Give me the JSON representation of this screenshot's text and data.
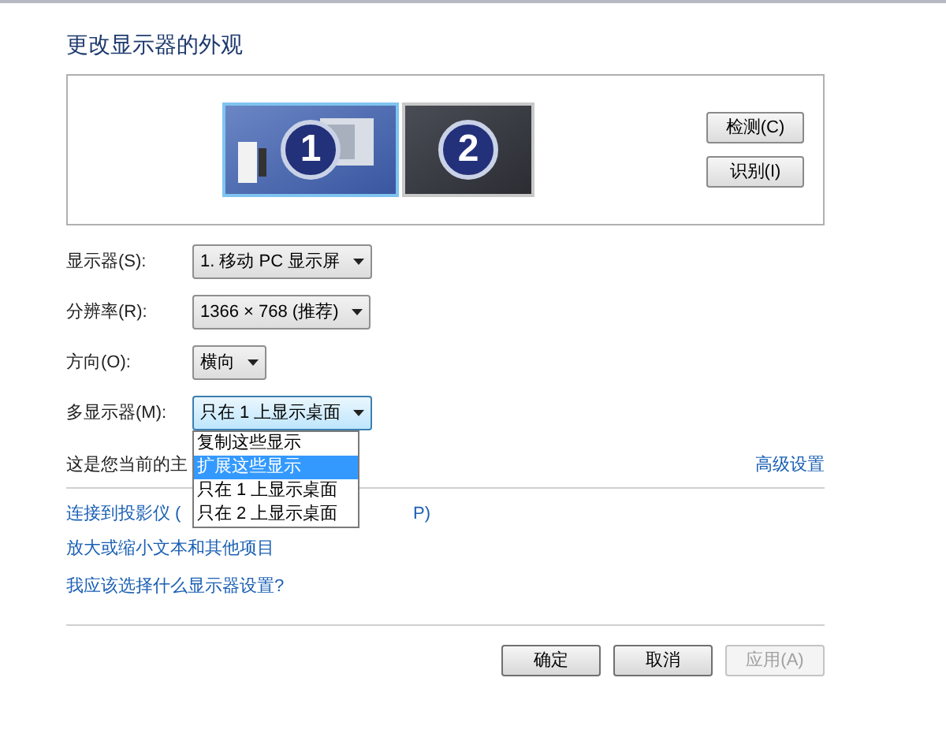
{
  "title": "更改显示器的外观",
  "monitors": [
    {
      "label": "1",
      "selected": true,
      "primary": true
    },
    {
      "label": "2",
      "selected": false,
      "primary": false
    }
  ],
  "side_buttons": [
    "检测(C)",
    "识别(I)"
  ],
  "settings": [
    {
      "label": "显示器(S):",
      "value": "1. 移动 PC 显示屏",
      "focused": false
    },
    {
      "label": "分辨率(R):",
      "value": "1366 × 768 (推荐)",
      "focused": false
    },
    {
      "label": "方向(O):",
      "value": "横向",
      "focused": false
    },
    {
      "label": "多显示器(M):",
      "value": "只在 1 上显示桌面",
      "focused": true
    }
  ],
  "dropdown_list": [
    {
      "label": "复制这些显示",
      "selected": false
    },
    {
      "label": "扩展这些显示",
      "selected": true
    },
    {
      "label": "只在 1 上显示桌面",
      "selected": false
    },
    {
      "label": "只在 2 上显示桌面",
      "selected": false
    }
  ],
  "primary_note": "这是您当前的主",
  "advanced_link": "高级设置",
  "projector_link": {
    "start": "连接到投影仪 (",
    "end": "P)"
  },
  "links": [
    "放大或缩小文本和其他项目",
    "我应该选择什么显示器设置?"
  ],
  "buttons": [
    {
      "label": "确定",
      "disabled": false
    },
    {
      "label": "取消",
      "disabled": false
    },
    {
      "label": "应用(A)",
      "disabled": true
    }
  ]
}
